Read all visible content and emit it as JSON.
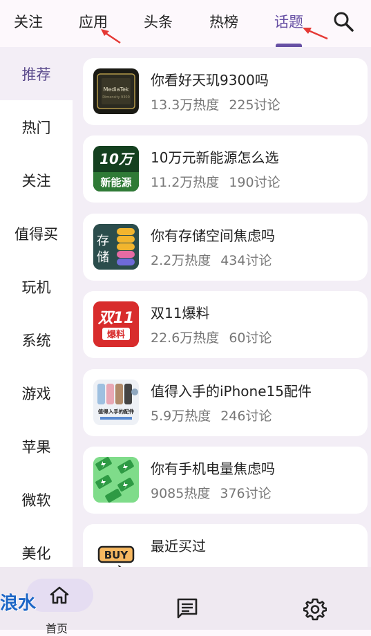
{
  "tabs": {
    "items": [
      "关注",
      "应用",
      "头条",
      "热榜",
      "话题"
    ],
    "active_index": 4
  },
  "categories": {
    "items": [
      "推荐",
      "热门",
      "关注",
      "值得买",
      "玩机",
      "系统",
      "游戏",
      "苹果",
      "微软",
      "美化"
    ],
    "active_index": 0
  },
  "topics": [
    {
      "title": "你看好天玑9300吗",
      "heat": "13.3万热度",
      "comments": "225讨论"
    },
    {
      "title": "10万元新能源怎么选",
      "heat": "11.2万热度",
      "comments": "190讨论",
      "thumb_text": "10万 新能源"
    },
    {
      "title": "你有存储空间焦虑吗",
      "heat": "2.2万热度",
      "comments": "434讨论",
      "thumb_text": "存储"
    },
    {
      "title": "双11爆料",
      "heat": "22.6万热度",
      "comments": "60讨论",
      "thumb_text": "双11 爆料"
    },
    {
      "title": "值得入手的iPhone15配件",
      "heat": "5.9万热度",
      "comments": "246讨论",
      "thumb_text": "值得入手的配件"
    },
    {
      "title": "你有手机电量焦虑吗",
      "heat": "9085热度",
      "comments": "376讨论"
    },
    {
      "title": "最近买过",
      "heat": "",
      "comments": "",
      "thumb_text": "BUY"
    }
  ],
  "bottom_nav": {
    "home_label": "首页"
  },
  "watermark": "浪水",
  "colors": {
    "accent": "#6750a4",
    "background": "#fdf8fc",
    "list_background": "#f3eef6",
    "arrow": "#e53935"
  },
  "icons": {
    "search": "search-icon",
    "home": "home-icon",
    "messages": "message-icon",
    "settings": "gear-icon"
  }
}
